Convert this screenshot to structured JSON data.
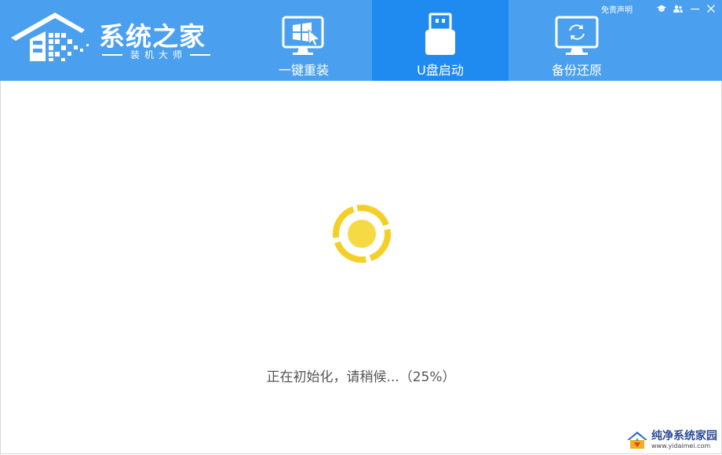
{
  "app": {
    "brand_name": "系统之家",
    "brand_sub": "装机大师"
  },
  "tabs": [
    {
      "label": "一键重装",
      "icon": "windows-monitor-icon",
      "active": false
    },
    {
      "label": "U盘启动",
      "icon": "usb-drive-icon",
      "active": true
    },
    {
      "label": "备份还原",
      "icon": "backup-restore-icon",
      "active": false
    }
  ],
  "topbar": {
    "disclaimer": "免责声明",
    "icons": [
      "graduation-cap-icon",
      "users-icon",
      "minimize-icon",
      "close-icon"
    ]
  },
  "main": {
    "status_text": "正在初始化，请稍候...（25%）",
    "progress_percent": 25
  },
  "watermark": {
    "title": "纯净系统家园",
    "url": "www.yidaimei.com"
  },
  "colors": {
    "header_bg": "#4aa0ee",
    "active_tab_bg": "#1f8bf1",
    "spinner": "#f5cf28"
  }
}
